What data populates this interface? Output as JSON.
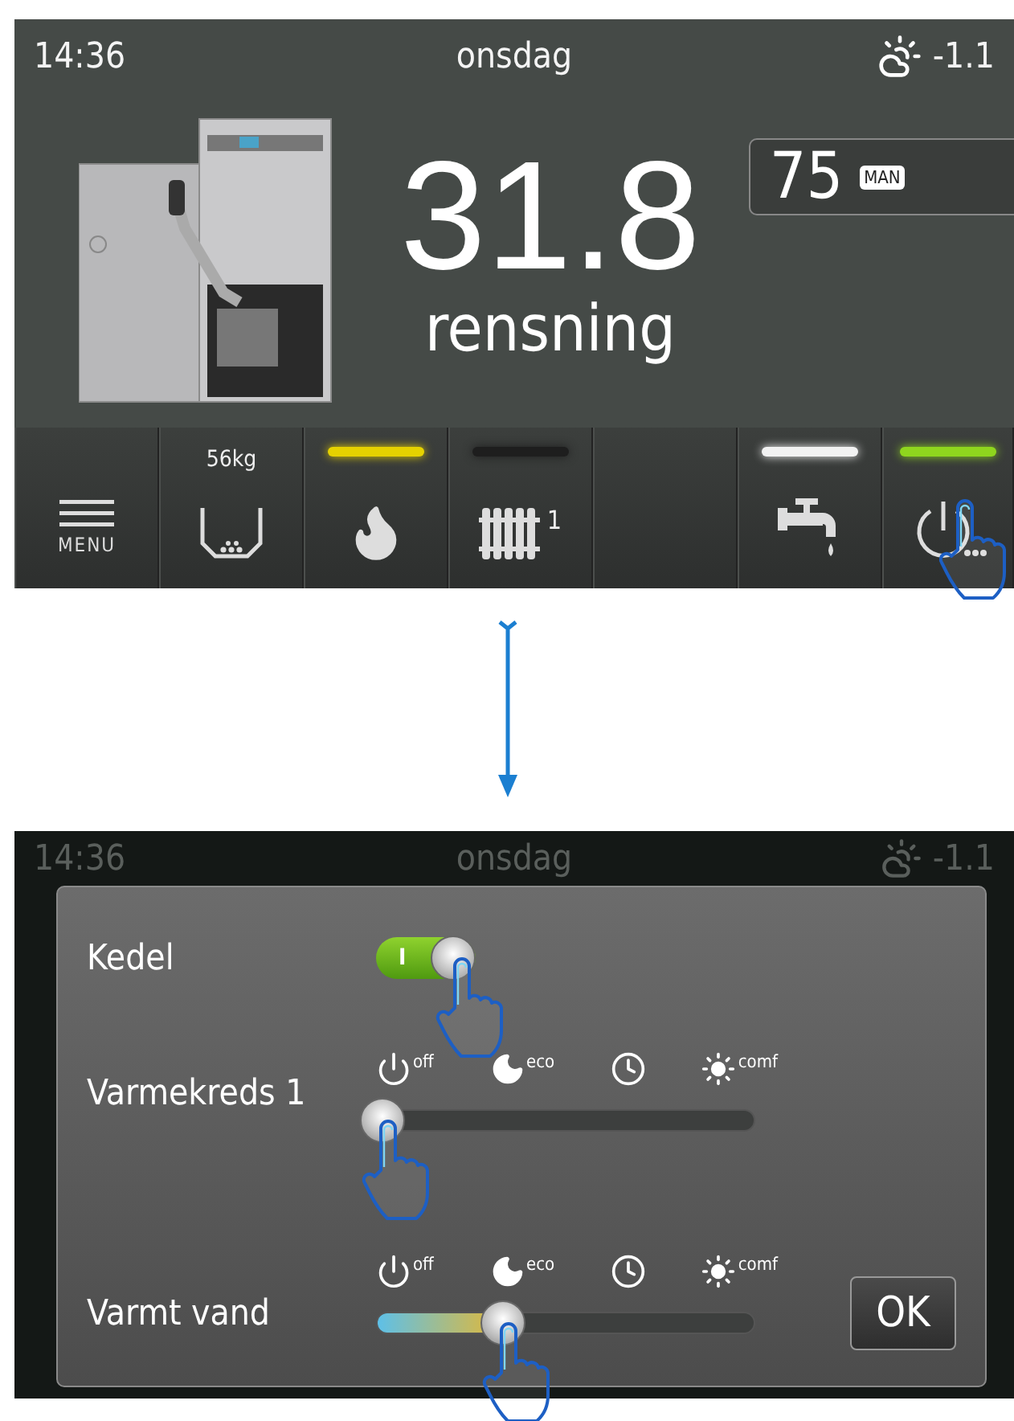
{
  "home_screen": {
    "time": "14:36",
    "day": "onsdag",
    "outdoor_temp": "-1.1",
    "boiler_temp": "31.8",
    "status": "rensning",
    "setpoint": {
      "value": "75",
      "mode": "MAN"
    },
    "buttons": [
      {
        "kind": "menu",
        "label": "MENU"
      },
      {
        "kind": "hopper",
        "label": "56kg"
      },
      {
        "kind": "flame",
        "color": "#e6d200"
      },
      {
        "kind": "radiator",
        "label": "1",
        "color": "#1e1e1e"
      },
      {
        "kind": "empty"
      },
      {
        "kind": "tap",
        "color": "#f2f2f2"
      },
      {
        "kind": "power",
        "color": "#8fd61e"
      }
    ]
  },
  "dialog_screen": {
    "time": "14:36",
    "day": "onsdag",
    "outdoor_temp": "-1.1",
    "rows": [
      {
        "kind": "toggle",
        "label": "Kedel",
        "on": true,
        "switch_text": "I"
      },
      {
        "kind": "slider",
        "label": "Varmekreds 1",
        "level": 0,
        "modes": [
          {
            "kind": "power",
            "label": "off"
          },
          {
            "kind": "moon",
            "label": "eco"
          },
          {
            "kind": "clock"
          },
          {
            "kind": "sun",
            "label": "comf"
          }
        ]
      },
      {
        "kind": "slider",
        "label": "Varmt vand",
        "level": 0.34,
        "modes": [
          {
            "kind": "power",
            "label": "off"
          },
          {
            "kind": "moon",
            "label": "eco"
          },
          {
            "kind": "clock"
          },
          {
            "kind": "sun",
            "label": "comf"
          }
        ]
      }
    ],
    "ok_button": "OK"
  }
}
